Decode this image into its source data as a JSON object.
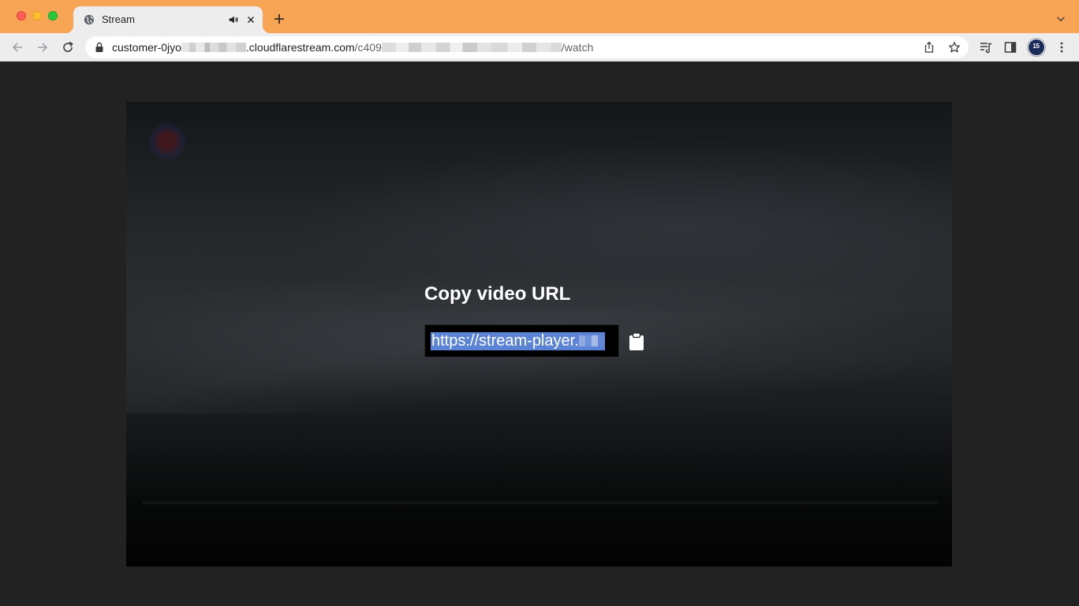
{
  "tab": {
    "title": "Stream"
  },
  "toolbar": {
    "url_prefix": "customer-0jyo",
    "url_host": ".cloudflarestream.com",
    "url_path_start": "/c409",
    "url_path_end": "/watch"
  },
  "profile": {
    "avatar_text": "15"
  },
  "dialog": {
    "title": "Copy video URL",
    "url_value": "https://stream-player."
  },
  "colors": {
    "tabstrip": "#f8a455",
    "toolbar": "#ededed",
    "page_background": "#222222",
    "selection": "#5b84d6"
  },
  "icons": [
    "globe-icon",
    "speaker-icon",
    "close-icon",
    "plus-icon",
    "chevron-down-icon",
    "back-arrow-icon",
    "forward-arrow-icon",
    "reload-icon",
    "lock-icon",
    "share-icon",
    "star-icon",
    "reading-list-icon",
    "side-panel-icon",
    "more-icon",
    "clipboard-icon"
  ]
}
